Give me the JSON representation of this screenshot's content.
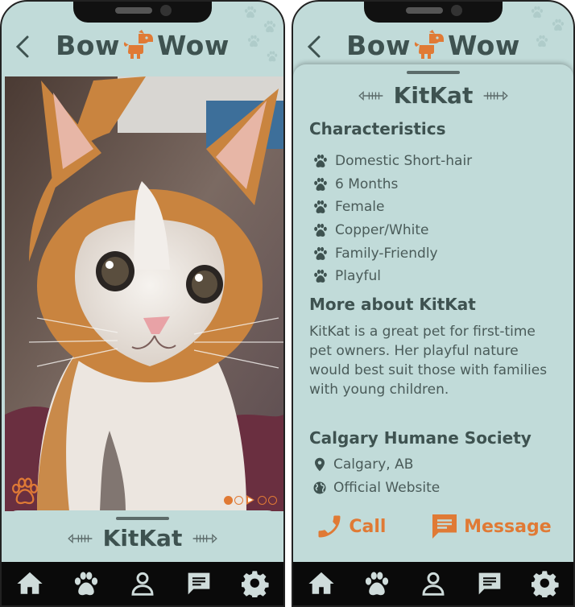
{
  "app": {
    "logo_left": "Bow",
    "logo_right": "Wow"
  },
  "left_screen": {
    "pet_name": "KitKat",
    "carousel": {
      "total": 5,
      "active_index": 0
    }
  },
  "right_screen": {
    "pet_name": "KitKat",
    "characteristics_title": "Characteristics",
    "characteristics": [
      "Domestic Short-hair",
      "6 Months",
      "Female",
      "Copper/White",
      "Family-Friendly",
      "Playful"
    ],
    "about_title": "More about KitKat",
    "about_text": "KitKat is a great pet for first-time pet owners. Her playful nature would best suit those with families with young children.",
    "shelter_name": "Calgary Humane Society",
    "shelter_location": "Calgary, AB",
    "shelter_website": "Official Website",
    "call_label": "Call",
    "message_label": "Message"
  },
  "nav": [
    "home-icon",
    "paw-icon",
    "profile-icon",
    "chat-icon",
    "settings-icon"
  ],
  "colors": {
    "accent": "#e07a35",
    "background": "#c1dbd9",
    "text": "#3e5250",
    "nav": "#0a0a0a"
  }
}
